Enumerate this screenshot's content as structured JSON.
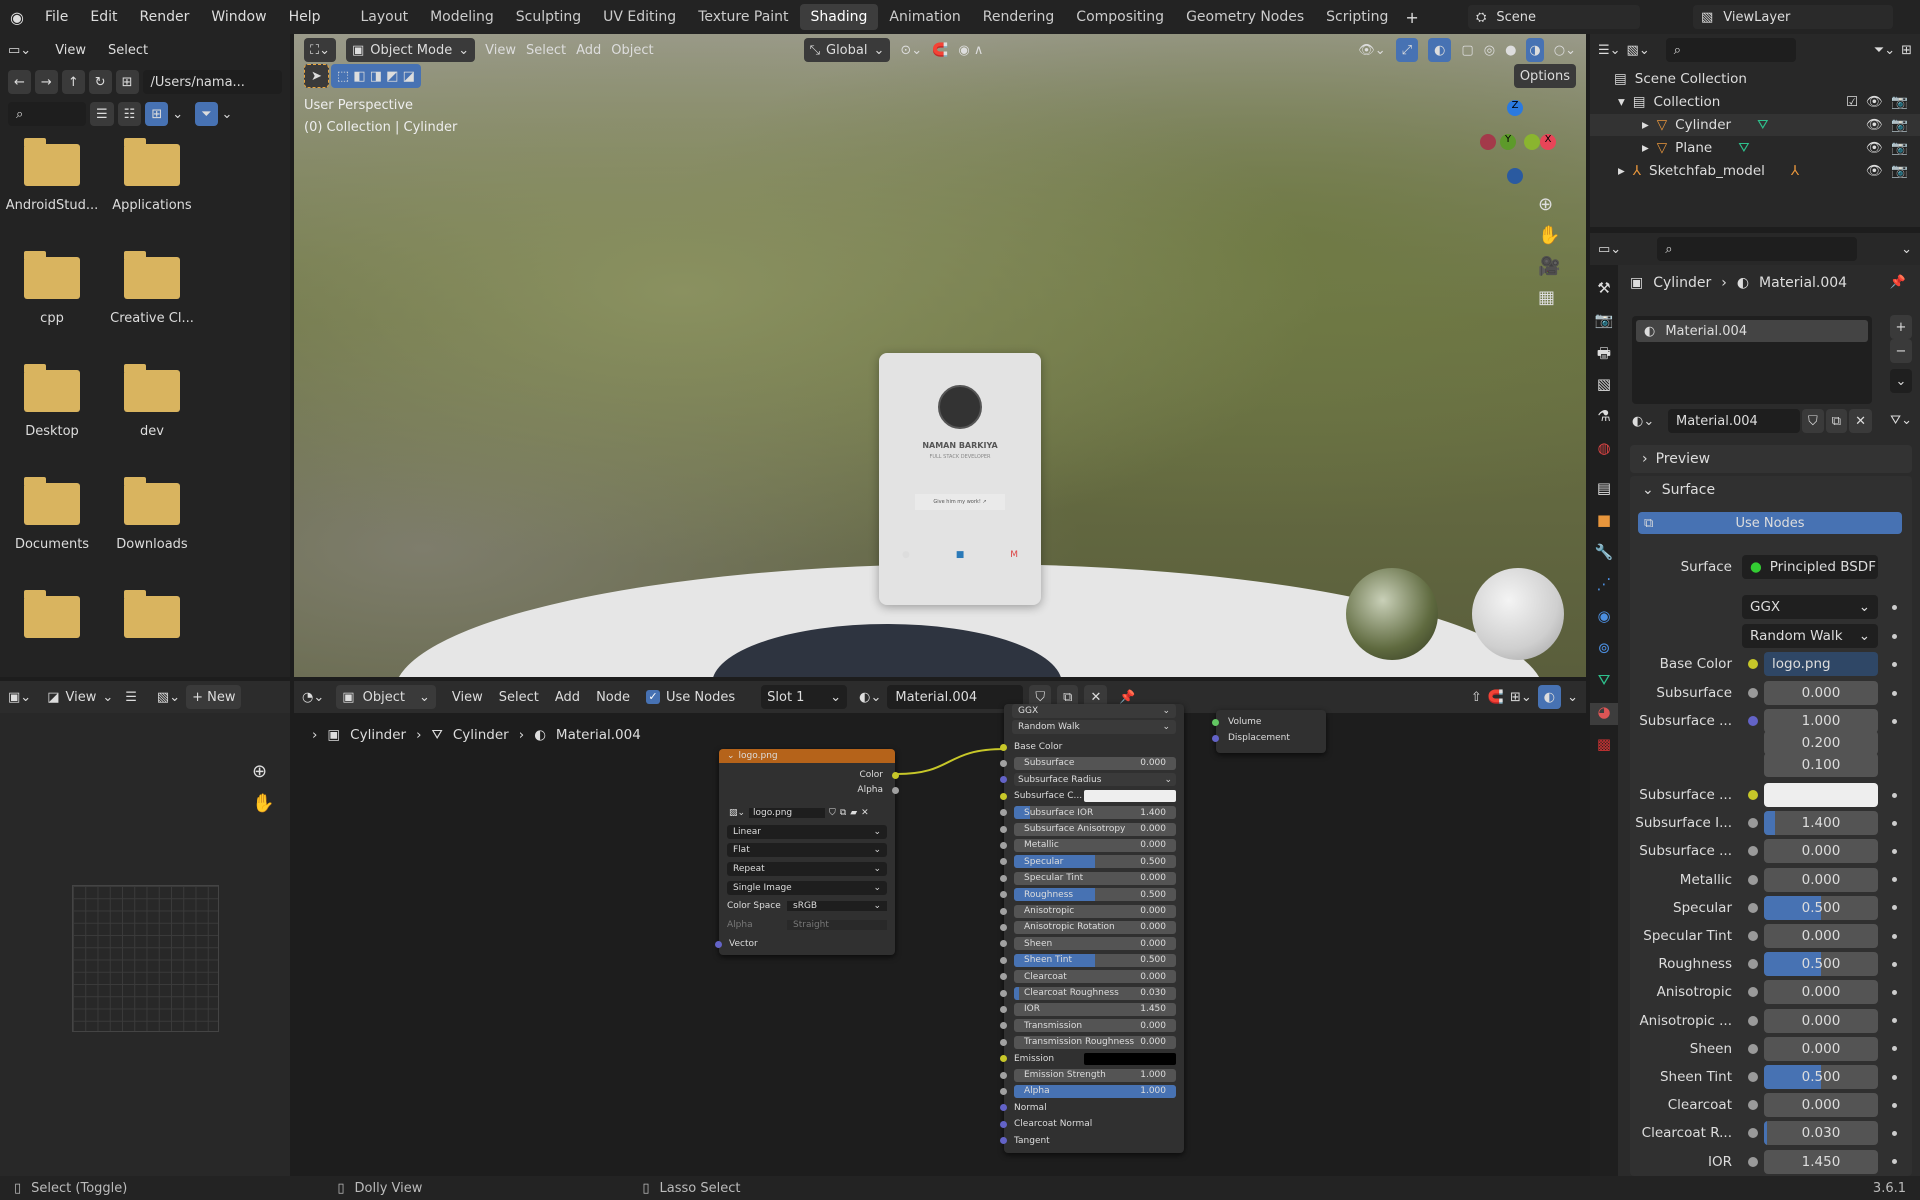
{
  "topbar": {
    "menus": [
      "File",
      "Edit",
      "Render",
      "Window",
      "Help"
    ],
    "workspaces": [
      "Layout",
      "Modeling",
      "Sculpting",
      "UV Editing",
      "Texture Paint",
      "Shading",
      "Animation",
      "Rendering",
      "Compositing",
      "Geometry Nodes",
      "Scripting"
    ],
    "active_workspace": "Shading",
    "scene": "Scene",
    "view_layer": "ViewLayer"
  },
  "file_browser": {
    "menus": [
      "View",
      "Select"
    ],
    "path": "/Users/nama...",
    "folders": [
      "AndroidStud...",
      "Applications",
      "cpp",
      "Creative Cl...",
      "Desktop",
      "dev",
      "Documents",
      "Downloads",
      "",
      ""
    ]
  },
  "viewport": {
    "mode": "Object Mode",
    "menus": [
      "View",
      "Select",
      "Add",
      "Object"
    ],
    "orientation": "Global",
    "options": "Options",
    "perspective": "User Perspective",
    "collection_info": "(0) Collection | Cylinder",
    "card": {
      "name": "NAMAN BARKIYA",
      "role": "FULL STACK DEVELOPER",
      "button": "Give him my work! ↗"
    },
    "gizmo": {
      "x": "X",
      "y": "Y",
      "z": "Z"
    }
  },
  "outliner": {
    "items": [
      {
        "label": "Scene Collection"
      },
      {
        "label": "Collection"
      },
      {
        "label": "Cylinder"
      },
      {
        "label": "Plane"
      },
      {
        "label": "Sketchfab_model"
      }
    ]
  },
  "properties": {
    "breadcrumb": {
      "object": "Cylinder",
      "material": "Material.004"
    },
    "slot": "Material.004",
    "material_name": "Material.004",
    "sections": {
      "preview": "Preview",
      "surface": "Surface"
    },
    "use_nodes": "Use Nodes",
    "surface_label": "Surface",
    "surface_value": "Principled BSDF",
    "distribution": "GGX",
    "subsurface_method": "Random Walk",
    "rows": [
      {
        "label": "Base Color",
        "value": "logo.png",
        "socket": "#c7c729"
      },
      {
        "label": "Subsurface",
        "value": "0.000",
        "fill": 0
      },
      {
        "label": "Subsurface ...",
        "value": "1.000",
        "fill": 0,
        "socket": "#6363c7"
      },
      {
        "label": "",
        "value": "0.200",
        "fill": 0
      },
      {
        "label": "",
        "value": "0.100",
        "fill": 0
      },
      {
        "label": "Subsurface ...",
        "value": "",
        "socket": "#c7c729",
        "color": "#eeeeee"
      },
      {
        "label": "Subsurface I...",
        "value": "1.400",
        "fill": 0.1
      },
      {
        "label": "Subsurface ...",
        "value": "0.000",
        "fill": 0
      },
      {
        "label": "Metallic",
        "value": "0.000",
        "fill": 0
      },
      {
        "label": "Specular",
        "value": "0.500",
        "fill": 0.5
      },
      {
        "label": "Specular Tint",
        "value": "0.000",
        "fill": 0
      },
      {
        "label": "Roughness",
        "value": "0.500",
        "fill": 0.5
      },
      {
        "label": "Anisotropic",
        "value": "0.000",
        "fill": 0
      },
      {
        "label": "Anisotropic ...",
        "value": "0.000",
        "fill": 0
      },
      {
        "label": "Sheen",
        "value": "0.000",
        "fill": 0
      },
      {
        "label": "Sheen Tint",
        "value": "0.500",
        "fill": 0.5
      },
      {
        "label": "Clearcoat",
        "value": "0.000",
        "fill": 0
      },
      {
        "label": "Clearcoat R...",
        "value": "0.030",
        "fill": 0.03
      },
      {
        "label": "IOR",
        "value": "1.450",
        "fill": 0
      }
    ]
  },
  "image_editor": {
    "view": "View",
    "new": "New"
  },
  "node_editor": {
    "object": "Object",
    "menus": [
      "View",
      "Select",
      "Add",
      "Node"
    ],
    "use_nodes": "Use Nodes",
    "slot": "Slot 1",
    "material": "Material.004",
    "breadcrumb": [
      "Cylinder",
      "Cylinder",
      "Material.004"
    ],
    "image_node": {
      "title": "logo.png",
      "outputs": [
        "Color",
        "Alpha"
      ],
      "image": "logo.png",
      "interpolation": "Linear",
      "projection": "Flat",
      "extension": "Repeat",
      "source": "Single Image",
      "color_space_label": "Color Space",
      "color_space": "sRGB",
      "alpha_label": "Alpha",
      "alpha": "Straight",
      "input": "Vector"
    },
    "bsdf_node": {
      "top": [
        "GGX",
        "Random Walk"
      ],
      "rows": [
        {
          "type": "socket",
          "label": "Base Color",
          "color": "#c7c729"
        },
        {
          "type": "value",
          "label": "Subsurface",
          "value": "0.000",
          "fill": 0
        },
        {
          "type": "dropdown",
          "label": "Subsurface Radius",
          "color": "#6363c7"
        },
        {
          "type": "color",
          "label": "Subsurface C...",
          "color": "#c7c729",
          "swatch": "#eeeeee"
        },
        {
          "type": "value",
          "label": "Subsurface IOR",
          "value": "1.400",
          "fill": 0.1
        },
        {
          "type": "value",
          "label": "Subsurface Anisotropy",
          "value": "0.000",
          "fill": 0
        },
        {
          "type": "value",
          "label": "Metallic",
          "value": "0.000",
          "fill": 0
        },
        {
          "type": "value",
          "label": "Specular",
          "value": "0.500",
          "fill": 0.5
        },
        {
          "type": "value",
          "label": "Specular Tint",
          "value": "0.000",
          "fill": 0
        },
        {
          "type": "value",
          "label": "Roughness",
          "value": "0.500",
          "fill": 0.5
        },
        {
          "type": "value",
          "label": "Anisotropic",
          "value": "0.000",
          "fill": 0
        },
        {
          "type": "value",
          "label": "Anisotropic Rotation",
          "value": "0.000",
          "fill": 0
        },
        {
          "type": "value",
          "label": "Sheen",
          "value": "0.000",
          "fill": 0
        },
        {
          "type": "value",
          "label": "Sheen Tint",
          "value": "0.500",
          "fill": 0.5
        },
        {
          "type": "value",
          "label": "Clearcoat",
          "value": "0.000",
          "fill": 0
        },
        {
          "type": "value",
          "label": "Clearcoat Roughness",
          "value": "0.030",
          "fill": 0.03
        },
        {
          "type": "value",
          "label": "IOR",
          "value": "1.450",
          "fill": 0
        },
        {
          "type": "value",
          "label": "Transmission",
          "value": "0.000",
          "fill": 0
        },
        {
          "type": "value",
          "label": "Transmission Roughness",
          "value": "0.000",
          "fill": 0
        },
        {
          "type": "color",
          "label": "Emission",
          "color": "#c7c729",
          "swatch": "#000000"
        },
        {
          "type": "value",
          "label": "Emission Strength",
          "value": "1.000",
          "fill": 0
        },
        {
          "type": "value",
          "label": "Alpha",
          "value": "1.000",
          "fill": 1
        },
        {
          "type": "socket",
          "label": "Normal",
          "color": "#6363c7"
        },
        {
          "type": "socket",
          "label": "Clearcoat Normal",
          "color": "#6363c7"
        },
        {
          "type": "socket",
          "label": "Tangent",
          "color": "#6363c7"
        }
      ]
    },
    "output_node": {
      "inputs": [
        {
          "label": "Volume",
          "color": "#63c763"
        },
        {
          "label": "Displacement",
          "color": "#6363c7"
        }
      ]
    }
  },
  "statusbar": {
    "items": [
      "Select (Toggle)",
      "Dolly View",
      "Lasso Select"
    ],
    "version": "3.6.1"
  }
}
